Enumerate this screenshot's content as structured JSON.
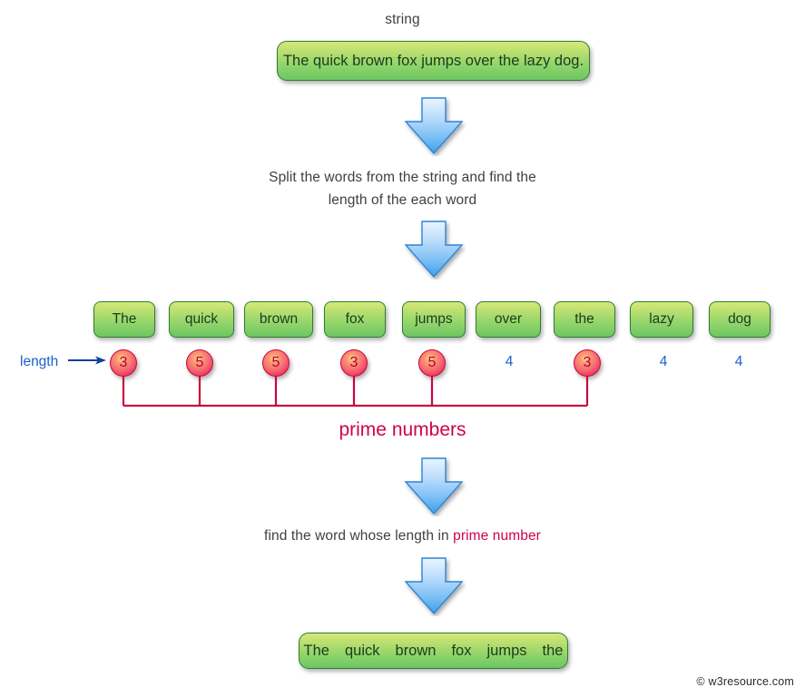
{
  "diagram": {
    "top_label": "string",
    "input_string": "The quick brown fox jumps over the lazy dog.",
    "step1_line1": "Split the words from the string and find the",
    "step1_line2": "length of the each word",
    "length_label": "length",
    "prime_bracket_label": "prime numbers",
    "step2_prefix": "find the word whose length in ",
    "step2_highlight": "prime number",
    "watermark": "© w3resource.com"
  },
  "words": [
    {
      "word": "The",
      "length": "3",
      "prime": true
    },
    {
      "word": "quick",
      "length": "5",
      "prime": true
    },
    {
      "word": "brown",
      "length": "5",
      "prime": true
    },
    {
      "word": "fox",
      "length": "3",
      "prime": true
    },
    {
      "word": "jumps",
      "length": "5",
      "prime": true
    },
    {
      "word": "over",
      "length": "4",
      "prime": false
    },
    {
      "word": "the",
      "length": "3",
      "prime": true
    },
    {
      "word": "lazy",
      "length": "4",
      "prime": false
    },
    {
      "word": "dog",
      "length": "4",
      "prime": false
    }
  ],
  "result_words": [
    "The",
    "quick",
    "brown",
    "fox",
    "jumps",
    "the"
  ],
  "colors": {
    "box_border": "#2d7d32",
    "box_fill_top": "#d6e97d",
    "box_fill_bottom": "#6dc663",
    "arrow_fill_top": "#dceeff",
    "arrow_fill_bottom": "#3aa0ef",
    "arrow_border": "#2f84d8",
    "prime_circle": "#d9003c",
    "prime_text": "#b30036",
    "nonprime_text": "#1a5fd0",
    "length_text": "#1a5fd0",
    "prime_label": "#d0004f",
    "caption_text": "#404040"
  },
  "layout": {
    "box_positions_x": [
      103,
      186,
      269,
      357,
      443,
      524,
      610,
      694,
      781
    ],
    "circle_center_x": [
      136,
      220,
      304,
      390,
      476,
      561,
      647,
      731,
      814
    ]
  }
}
